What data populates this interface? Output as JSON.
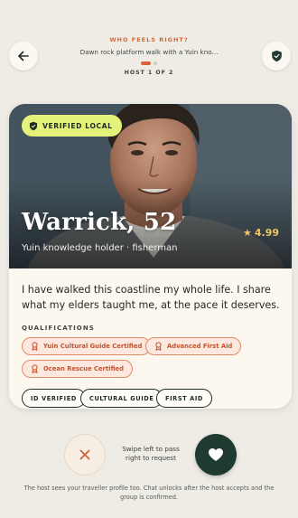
{
  "header": {
    "kicker": "WHO FEELS RIGHT?",
    "trip_title": "Dawn rock platform walk with a Yuin kno...",
    "host_counter": "HOST 1 OF 2",
    "page_dots": {
      "total": 2,
      "active_index": 0
    }
  },
  "host": {
    "verified_badge": "VERIFIED LOCAL",
    "name": "Warrick, 52",
    "role": "Yuin knowledge holder · fisherman",
    "rating": "4.99",
    "bio": "I have walked this coastline my whole life. I share what my elders taught me, at the pace it deserves.",
    "qualifications_label": "QUALIFICATIONS",
    "certifications": [
      {
        "label": "Yuin Cultural Guide Certified",
        "icon": "award-icon"
      },
      {
        "label": "Advanced First Aid",
        "icon": "award-icon"
      },
      {
        "label": "Ocean Rescue Certified",
        "icon": "award-icon"
      }
    ],
    "tags": [
      "ID VERIFIED",
      "CULTURAL GUIDE",
      "FIRST AID"
    ]
  },
  "actions": {
    "pass_icon": "close-icon",
    "request_icon": "heart-icon",
    "swipe_hint": "Swipe left to pass right to request"
  },
  "footer": {
    "note": "The host sees your traveller profile too. Chat unlocks after the host accepts and the group is confirmed."
  },
  "colors": {
    "background": "#efece6",
    "accent": "#d9643a",
    "verified_badge": "#e5f27a",
    "request_button": "#1f3a30",
    "rating_star": "#f0c463"
  }
}
